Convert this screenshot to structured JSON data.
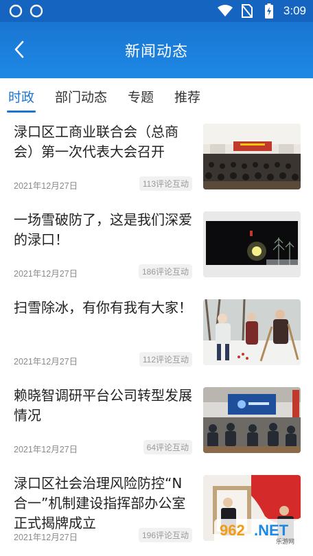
{
  "status_bar": {
    "time": "3:09",
    "icons": [
      "sync-icon",
      "sync-icon",
      "wifi-icon",
      "no-sim-icon",
      "battery-charging-icon"
    ]
  },
  "header": {
    "back_icon": "chevron-left-icon",
    "title": "新闻动态"
  },
  "tabs": [
    {
      "label": "时政",
      "active": true
    },
    {
      "label": "部门动态",
      "active": false
    },
    {
      "label": "专题",
      "active": false
    },
    {
      "label": "推荐",
      "active": false
    }
  ],
  "news": [
    {
      "title": "渌口区工商业联合会（总商会）第一次代表大会召开",
      "date": "2021年12月27日",
      "comments": "113评论互动"
    },
    {
      "title": "一场雪破防了，这是我们深爱的渌口！",
      "date": "2021年12月27日",
      "comments": "186评论互动"
    },
    {
      "title": "扫雪除冰，有你有我有大家！",
      "date": "2021年12月27日",
      "comments": "112评论互动"
    },
    {
      "title": "赖晓智调研平台公司转型发展情况",
      "date": "2021年12月27日",
      "comments": "64评论互动"
    },
    {
      "title": "渌口区社会治理风险防控“N合一”机制建设指挥部办公室正式揭牌成立",
      "date": "2021年12月27日",
      "comments": "196评论互动"
    }
  ],
  "watermark": {
    "text": "962.NET",
    "subtext": "乐游网"
  },
  "colors": {
    "primary": "#1976d2",
    "status_bar": "#1565c0",
    "date_text": "#8a8a8a"
  }
}
